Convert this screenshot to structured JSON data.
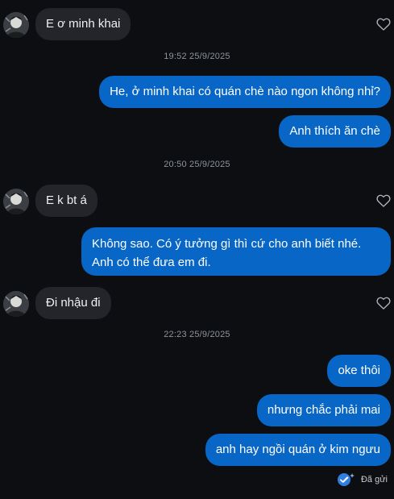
{
  "conversation": {
    "messages": [
      {
        "text": "E ơ minh khai"
      },
      {
        "text": "He, ở minh khai có quán chè nào ngon không nhỉ?"
      },
      {
        "text": "Anh thích ăn chè"
      },
      {
        "text": "E k bt á"
      },
      {
        "text": "Không sao. Có ý tưởng gì thì cứ cho anh biết nhé. Anh có thể đưa em đi."
      },
      {
        "text": "Đi nhậu đi"
      },
      {
        "text": "oke thôi"
      },
      {
        "text": "nhưng chắc phải mai"
      },
      {
        "text": "anh hay ngồi quán ở kim ngưu"
      }
    ],
    "timestamps": [
      "19:52 25/9/2025",
      "20:50 25/9/2025",
      "22:23 25/9/2025"
    ],
    "status": {
      "label": "Đã gửi",
      "icon": "sent-check-icon"
    }
  },
  "colors": {
    "background": "#0c0e12",
    "incoming_bubble": "#23252b",
    "outgoing_bubble": "#0866c6",
    "timestamp": "#8e939b"
  }
}
